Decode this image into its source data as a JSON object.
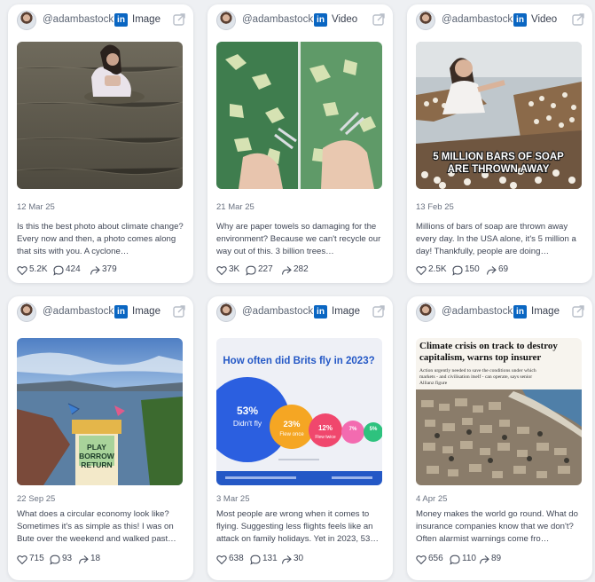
{
  "cards": [
    {
      "handle": "@adambastock",
      "post_type": "Image",
      "date": "12 Mar 25",
      "text": "Is this the best photo about climate change? Every now and then, a photo comes along that sits with you. A cyclone…",
      "likes": "5.2K",
      "comments": "424",
      "reposts": "379"
    },
    {
      "handle": "@adambastock",
      "post_type": "Video",
      "date": "21 Mar 25",
      "text": "Why are paper towels so damaging for the environment? Because we can't recycle our way out of this. 3 billion trees…",
      "likes": "3K",
      "comments": "227",
      "reposts": "282"
    },
    {
      "handle": "@adambastock",
      "post_type": "Video",
      "date": "13 Feb 25",
      "text": "Millions of bars of soap are thrown away every day. In the USA alone, it's 5 million a day! Thankfully, people are doing…",
      "likes": "2.5K",
      "comments": "150",
      "reposts": "69",
      "overlay_caption_line1": "5 MILLION BARS OF SOAP",
      "overlay_caption_line2": "ARE THROWN AWAY"
    },
    {
      "handle": "@adambastock",
      "post_type": "Image",
      "date": "22 Sep 25",
      "text": "What does a circular economy look like? Sometimes it's as simple as this! I was on Bute over the weekend and walked past…",
      "likes": "715",
      "comments": "93",
      "reposts": "18",
      "sign_line1": "PLAY",
      "sign_line2": "BORROW",
      "sign_line3": "RETURN"
    },
    {
      "handle": "@adambastock",
      "post_type": "Image",
      "date": "3 Mar 25",
      "text": "Most people are wrong when it comes to flying. Suggesting less flights feels like an attack on family holidays. Yet in 2023, 53…",
      "likes": "638",
      "comments": "131",
      "reposts": "30",
      "infographic": {
        "title": "How often did Brits fly in 2023?",
        "b1_value": "53%",
        "b1_label": "Didn't fly",
        "b2_value": "23%",
        "b2_label": "Flew once",
        "b3_value": "12%",
        "b3_label": "Flew twice",
        "b4_value": "7%",
        "b5_value": "5%"
      }
    },
    {
      "handle": "@adambastock",
      "post_type": "Image",
      "date": "4 Apr 25",
      "text": "Money makes the world go round. What do insurance companies know that we don't? Often alarmist warnings come fro…",
      "likes": "656",
      "comments": "110",
      "reposts": "89",
      "news": {
        "headline_line1": "Climate crisis on track to destroy",
        "headline_line2": "capitalism, warns top insurer",
        "standfirst_line1": "Action urgently needed to save the conditions under which",
        "standfirst_line2": "markets - and civilisation itself - can operate, says senior",
        "standfirst_line3": "Allianz figure"
      }
    }
  ],
  "colors": {
    "linkedin": "#0a66c2",
    "card_bg": "#ffffff",
    "page_bg": "#eef0f3"
  },
  "icons": {
    "platform": "linkedin-icon",
    "open": "external-link-icon",
    "like": "heart-icon",
    "comment": "comment-icon",
    "repost": "share-icon"
  }
}
